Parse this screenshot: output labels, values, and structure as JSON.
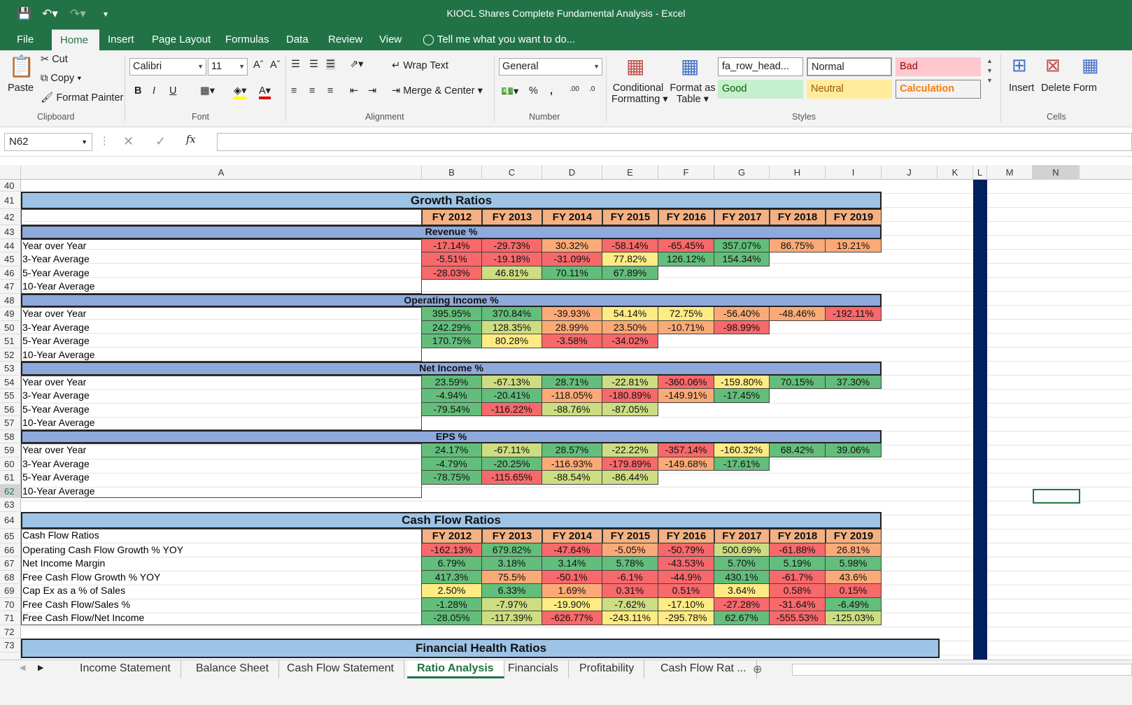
{
  "window": {
    "title": "KIOCL Shares Complete Fundamental Analysis - Excel"
  },
  "menu": [
    "File",
    "Home",
    "Insert",
    "Page Layout",
    "Formulas",
    "Data",
    "Review",
    "View"
  ],
  "tell_me": "Tell me what you want to do...",
  "ribbon": {
    "clipboard": {
      "paste": "Paste",
      "cut": "Cut",
      "copy": "Copy",
      "format_painter": "Format Painter",
      "label": "Clipboard"
    },
    "font": {
      "name": "Calibri",
      "size": "11",
      "label": "Font",
      "bold": "B",
      "italic": "I",
      "underline": "U"
    },
    "alignment": {
      "wrap": "Wrap Text",
      "merge": "Merge & Center",
      "label": "Alignment"
    },
    "number": {
      "format": "General",
      "percent": "%",
      "comma": ",",
      "label": "Number"
    },
    "cond_format": [
      "Conditional",
      "Formatting"
    ],
    "format_table": [
      "Format as",
      "Table"
    ],
    "styles": {
      "label": "Styles",
      "items": [
        "fa_row_head...",
        "Normal",
        "Bad",
        "Good",
        "Neutral",
        "Calculation"
      ]
    },
    "cells": {
      "insert": "Insert",
      "delete": "Delete",
      "format": "Form",
      "label": "Cells"
    }
  },
  "name_box": "N62",
  "fx": "fx",
  "columns": [
    "A",
    "B",
    "C",
    "D",
    "E",
    "F",
    "G",
    "H",
    "I",
    "J",
    "K",
    "L",
    "M",
    "N"
  ],
  "rows": [
    "40",
    "41",
    "42",
    "43",
    "44",
    "45",
    "46",
    "47",
    "48",
    "49",
    "50",
    "51",
    "52",
    "53",
    "54",
    "55",
    "56",
    "57",
    "58",
    "59",
    "60",
    "61",
    "62",
    "63",
    "64",
    "65",
    "66",
    "67",
    "68",
    "69",
    "70",
    "71",
    "72",
    "73"
  ],
  "sheet": {
    "growth_title": "Growth Ratios",
    "years": [
      "FY 2012",
      "FY 2013",
      "FY 2014",
      "FY 2015",
      "FY 2016",
      "FY 2017",
      "FY 2018",
      "FY 2019"
    ],
    "row_labels": [
      "Year over Year",
      "3-Year Average",
      "5-Year Average",
      "10-Year Average"
    ],
    "sections": [
      {
        "title": "Revenue %",
        "rows": [
          [
            "-17.14%",
            "-29.73%",
            "30.32%",
            "-58.14%",
            "-65.45%",
            "357.07%",
            "86.75%",
            "19.21%"
          ],
          [
            "-5.51%",
            "-19.18%",
            "-31.09%",
            "77.82%",
            "126.12%",
            "154.34%"
          ],
          [
            "-28.03%",
            "46.81%",
            "70.11%",
            "67.89%"
          ]
        ]
      },
      {
        "title": "Operating Income %",
        "rows": [
          [
            "395.95%",
            "370.84%",
            "-39.93%",
            "54.14%",
            "72.75%",
            "-56.40%",
            "-48.46%",
            "-192.11%"
          ],
          [
            "242.29%",
            "128.35%",
            "28.99%",
            "23.50%",
            "-10.71%",
            "-98.99%"
          ],
          [
            "170.75%",
            "80.28%",
            "-3.58%",
            "-34.02%"
          ]
        ]
      },
      {
        "title": "Net Income %",
        "rows": [
          [
            "23.59%",
            "-67.13%",
            "28.71%",
            "-22.81%",
            "-360.06%",
            "-159.80%",
            "70.15%",
            "37.30%"
          ],
          [
            "-4.94%",
            "-20.41%",
            "-118.05%",
            "-180.89%",
            "-149.91%",
            "-17.45%"
          ],
          [
            "-79.54%",
            "-116.22%",
            "-88.76%",
            "-87.05%"
          ]
        ]
      },
      {
        "title": "EPS %",
        "rows": [
          [
            "24.17%",
            "-67.11%",
            "28.57%",
            "-22.22%",
            "-357.14%",
            "-160.32%",
            "68.42%",
            "39.06%"
          ],
          [
            "-4.79%",
            "-20.25%",
            "-116.93%",
            "-179.89%",
            "-149.68%",
            "-17.61%"
          ],
          [
            "-78.75%",
            "-115.65%",
            "-88.54%",
            "-86.44%"
          ]
        ]
      }
    ],
    "cf_title": "Cash Flow Ratios",
    "cf_rows": [
      {
        "label": "Cash Flow Ratios",
        "values": []
      },
      {
        "label": "Operating Cash Flow Growth % YOY",
        "values": [
          "-162.13%",
          "679.82%",
          "-47.64%",
          "-5.05%",
          "-50.79%",
          "500.69%",
          "-61.88%",
          "26.81%"
        ]
      },
      {
        "label": "Net Income Margin",
        "values": [
          "6.79%",
          "3.18%",
          "3.14%",
          "5.78%",
          "-43.53%",
          "5.70%",
          "5.19%",
          "5.98%"
        ]
      },
      {
        "label": "Free Cash Flow Growth % YOY",
        "values": [
          "417.3%",
          "75.5%",
          "-50.1%",
          "-6.1%",
          "-44.9%",
          "430.1%",
          "-61.7%",
          "43.6%"
        ]
      },
      {
        "label": "Cap Ex as a % of Sales",
        "values": [
          "2.50%",
          "6.33%",
          "1.69%",
          "0.31%",
          "0.51%",
          "3.64%",
          "0.58%",
          "0.15%"
        ]
      },
      {
        "label": "Free Cash Flow/Sales %",
        "values": [
          "-1.28%",
          "-7.97%",
          "-19.90%",
          "-7.62%",
          "-17.10%",
          "-27.28%",
          "-31.64%",
          "-6.49%"
        ]
      },
      {
        "label": "Free Cash Flow/Net Income",
        "values": [
          "-28.05%",
          "-117.39%",
          "-626.77%",
          "-243.11%",
          "-295.78%",
          "62.67%",
          "-555.53%",
          "-125.03%"
        ]
      }
    ],
    "fh_title": "Financial Health Ratios"
  },
  "tabs": [
    "Income Statement",
    "Balance Sheet",
    "Cash Flow Statement",
    "Ratio Analysis",
    "Financials",
    "Profitability",
    "Cash Flow Rat ..."
  ],
  "active_tab": "Ratio Analysis",
  "colors": {
    "excel_green": "#217346",
    "red": "#f8696b",
    "orange": "#fbaa77",
    "yellow": "#ffeb84",
    "lightgreen": "#cddd82",
    "green": "#63be7b",
    "navy": "#002060"
  }
}
